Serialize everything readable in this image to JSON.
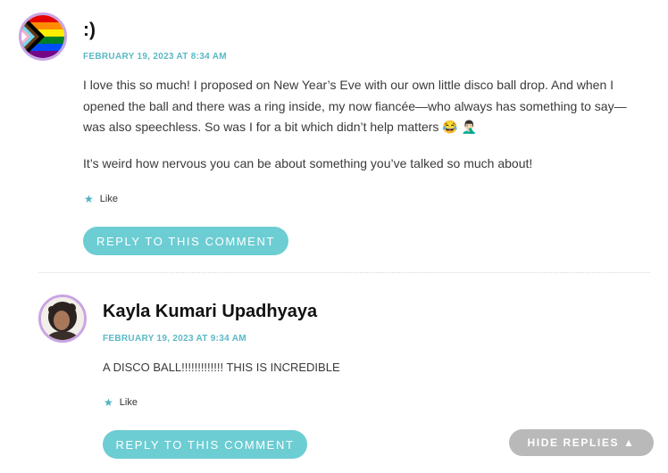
{
  "comment": {
    "author": ":)",
    "date": "FEBRUARY 19, 2023 AT 8:34 AM",
    "paragraph1": "I love this so much! I proposed on New Year’s Eve with our own little disco ball drop. And when I opened the ball and there was a ring inside, my now fiancée—who always has something to say—was also speechless. So was I for a bit which didn’t help matters 😂 🤦🏻‍♂️",
    "paragraph2": "It’s weird how nervous you can be about something you’ve talked so much about!",
    "like_label": "Like",
    "reply_label": "REPLY TO THIS COMMENT"
  },
  "reply": {
    "author": "Kayla Kumari Upadhyaya",
    "date": "FEBRUARY 19, 2023 AT 9:34 AM",
    "paragraph1": "A DISCO BALL!!!!!!!!!!!!! THIS IS INCREDIBLE",
    "like_label": "Like",
    "reply_label": "REPLY TO THIS COMMENT"
  },
  "hide_replies_label": "HIDE REPLIES ▲",
  "colors": {
    "accent": "#5ab9c6",
    "button": "#6ccdd3",
    "hide_button": "#b9b9b9",
    "avatar_border": "#c9a5e3"
  }
}
